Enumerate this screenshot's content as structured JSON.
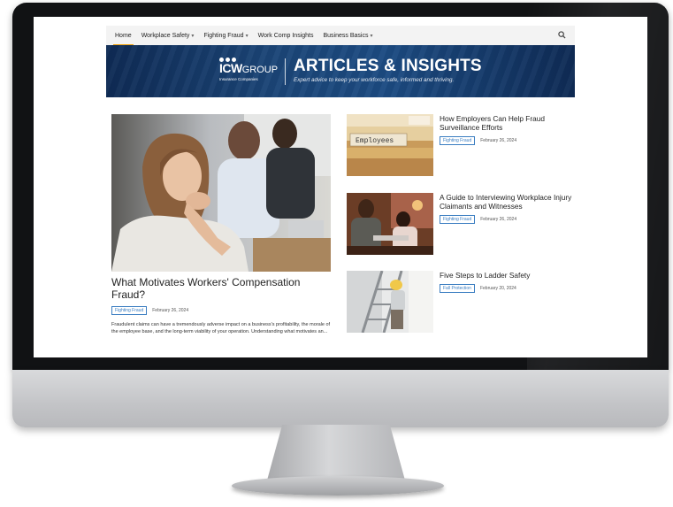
{
  "nav": {
    "items": [
      {
        "label": "Home",
        "active": true,
        "dropdown": false
      },
      {
        "label": "Workplace Safety",
        "active": false,
        "dropdown": true
      },
      {
        "label": "Fighting Fraud",
        "active": false,
        "dropdown": true
      },
      {
        "label": "Work Comp Insights",
        "active": false,
        "dropdown": false
      },
      {
        "label": "Business Basics",
        "active": false,
        "dropdown": true
      }
    ],
    "search_icon": "search-icon"
  },
  "banner": {
    "logo_main": "ICW",
    "logo_group": "GROUP",
    "logo_sub": "Insurance Companies",
    "title": "ARTICLES & INSIGHTS",
    "subtitle": "Expert advice to keep your workforce safe, informed and thriving."
  },
  "featured": {
    "title": "What Motivates Workers' Compensation Fraud?",
    "tag": "Fighting Fraud",
    "date": "February 26, 2024",
    "excerpt": "Fraudulent claims can have a tremendously adverse impact on a business's profitability, the morale of the employee base, and the long-term viability of your operation. Understanding what motivates an..."
  },
  "articles": [
    {
      "title": "How Employers Can Help Fraud Surveillance Efforts",
      "tag": "Fighting Fraud",
      "date": "February 26, 2024",
      "image_label": "Employees"
    },
    {
      "title": "A Guide to Interviewing Workplace Injury Claimants and Witnesses",
      "tag": "Fighting Fraud",
      "date": "February 26, 2024"
    },
    {
      "title": "Five Steps to Ladder Safety",
      "tag": "Fall Protection",
      "date": "February 20, 2024"
    }
  ],
  "colors": {
    "accent": "#f0a10a",
    "banner": "#1b4577",
    "tag": "#3a7dc1"
  }
}
